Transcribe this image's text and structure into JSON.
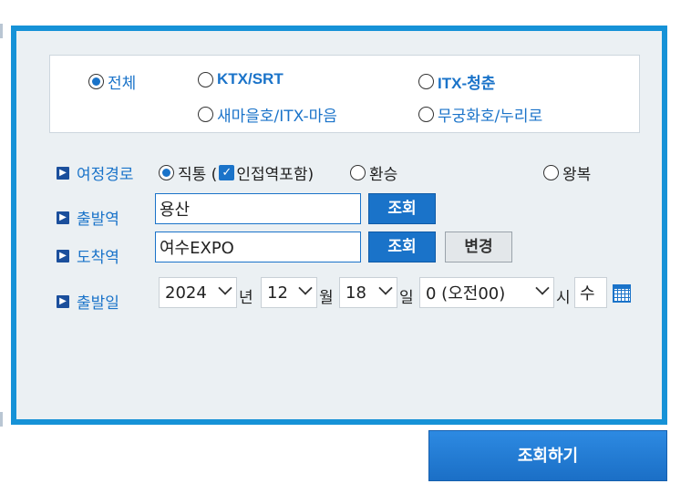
{
  "train_types": [
    {
      "label": "전체",
      "checked": true
    },
    {
      "label": "KTX/SRT",
      "checked": false
    },
    {
      "label": "ITX-청춘",
      "checked": false
    },
    {
      "label": "새마을호/ITX-마음",
      "checked": false
    },
    {
      "label": "무궁화호/누리로",
      "checked": false
    }
  ],
  "route": {
    "label": "여정경로",
    "options": {
      "direct": "직통 (",
      "nearby": "인접역포함)",
      "transfer": "환승",
      "roundtrip": "왕복"
    }
  },
  "departure": {
    "label": "출발역",
    "value": "용산",
    "search_label": "조회"
  },
  "arrival": {
    "label": "도착역",
    "value": "여수EXPO",
    "search_label": "조회",
    "change_label": "변경"
  },
  "date": {
    "label": "출발일",
    "year": "2024",
    "year_unit": "년",
    "month": "12",
    "month_unit": "월",
    "day": "18",
    "day_unit": "일",
    "hour": "0 (오전00)",
    "hour_unit": "시",
    "weekday": "수"
  },
  "submit_label": "조회하기",
  "colors": {
    "panel_border": "#1692d7",
    "accent": "#1a73c9",
    "panel_bg": "#ebf0f3"
  }
}
